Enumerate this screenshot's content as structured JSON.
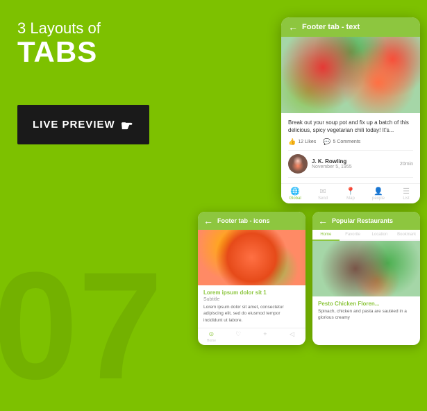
{
  "watermark": "07",
  "header": {
    "title_small": "3 Layouts of",
    "title_large": "TABS"
  },
  "button": {
    "label": "LIVE PREVIEW"
  },
  "phone_main": {
    "header_title": "Footer tab - text",
    "description": "Break out your soup pot and fix up a batch of this delicious, spicy vegetarian chili today! It's...",
    "likes": "12 Likes",
    "comments": "5 Comments",
    "author_name": "J. K. Rowling",
    "author_date": "November 5, 1955",
    "read_time": "20min",
    "tabs": [
      "Global",
      "Send",
      "Map",
      "people",
      "List"
    ]
  },
  "phone_small1": {
    "header_title": "Footer tab - icons",
    "content_title": "Lorem ipsum dolor sit 1",
    "subtitle": "Subtitle",
    "description": "Lorem ipsum dolor sit amet, consectetur adipiscing elit, sed do eiusmod tempor incididunt ut labore."
  },
  "phone_small2": {
    "header_title": "Popular Restaurants",
    "tabs": [
      "Home",
      "Favorite",
      "Location",
      "Bookmark"
    ],
    "content_title": "Pesto Chicken Floren...",
    "description": "Spinach, chicken and pasta are sautéed in a glorious creamy"
  }
}
